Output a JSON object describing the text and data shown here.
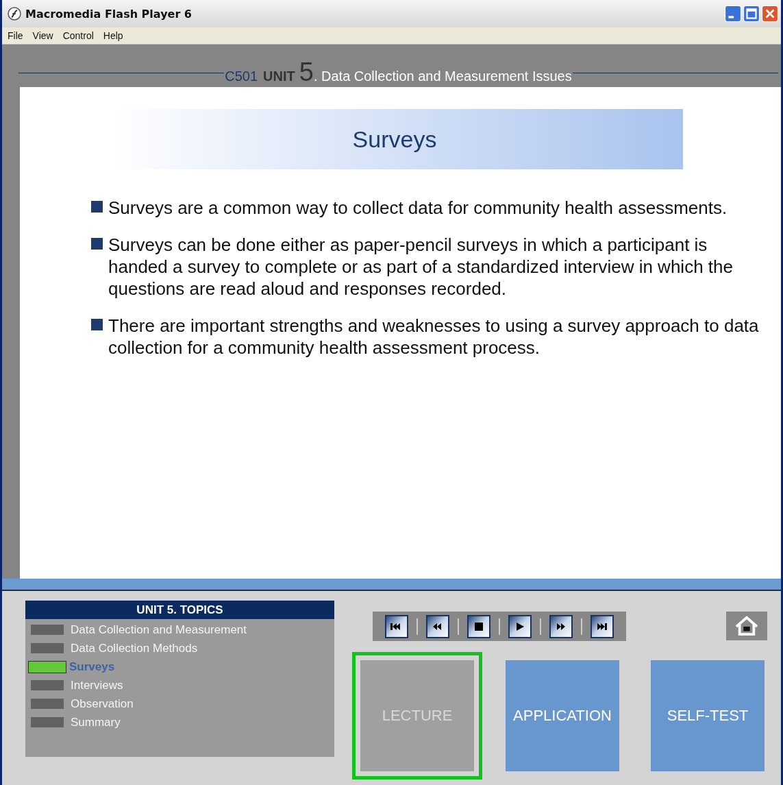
{
  "window": {
    "title": "Macromedia Flash Player 6"
  },
  "menu": [
    "File",
    "View",
    "Control",
    "Help"
  ],
  "header": {
    "code": "C501",
    "unit_label": "UNIT",
    "unit_number": "5",
    "title": ". Data Collection and Measurement Issues"
  },
  "slide": {
    "title": "Surveys",
    "bullets": [
      "Surveys are a common way to collect data for community health assessments.",
      "Surveys can be done either as paper-pencil surveys in which a participant is handed a survey to complete or as part of a standardized interview in which the questions are read aloud and responses recorded.",
      "There are important strengths and weaknesses to using a survey approach to data collection for a community health assessment process."
    ]
  },
  "topics": {
    "title": "UNIT 5. TOPICS",
    "items": [
      {
        "label": "Data Collection and Measurement",
        "selected": false
      },
      {
        "label": "Data Collection Methods",
        "selected": false
      },
      {
        "label": "Surveys",
        "selected": true
      },
      {
        "label": "Interviews",
        "selected": false
      },
      {
        "label": "Observation",
        "selected": false
      },
      {
        "label": "Summary",
        "selected": false
      }
    ]
  },
  "media_controls": [
    {
      "kind": "first"
    },
    {
      "kind": "rewind"
    },
    {
      "kind": "stop"
    },
    {
      "kind": "play"
    },
    {
      "kind": "forward"
    },
    {
      "kind": "last"
    }
  ],
  "sections": [
    {
      "label": "LECTURE",
      "selected": true
    },
    {
      "label": "APPLICATION",
      "selected": false
    },
    {
      "label": "SELF-TEST",
      "selected": false
    }
  ]
}
